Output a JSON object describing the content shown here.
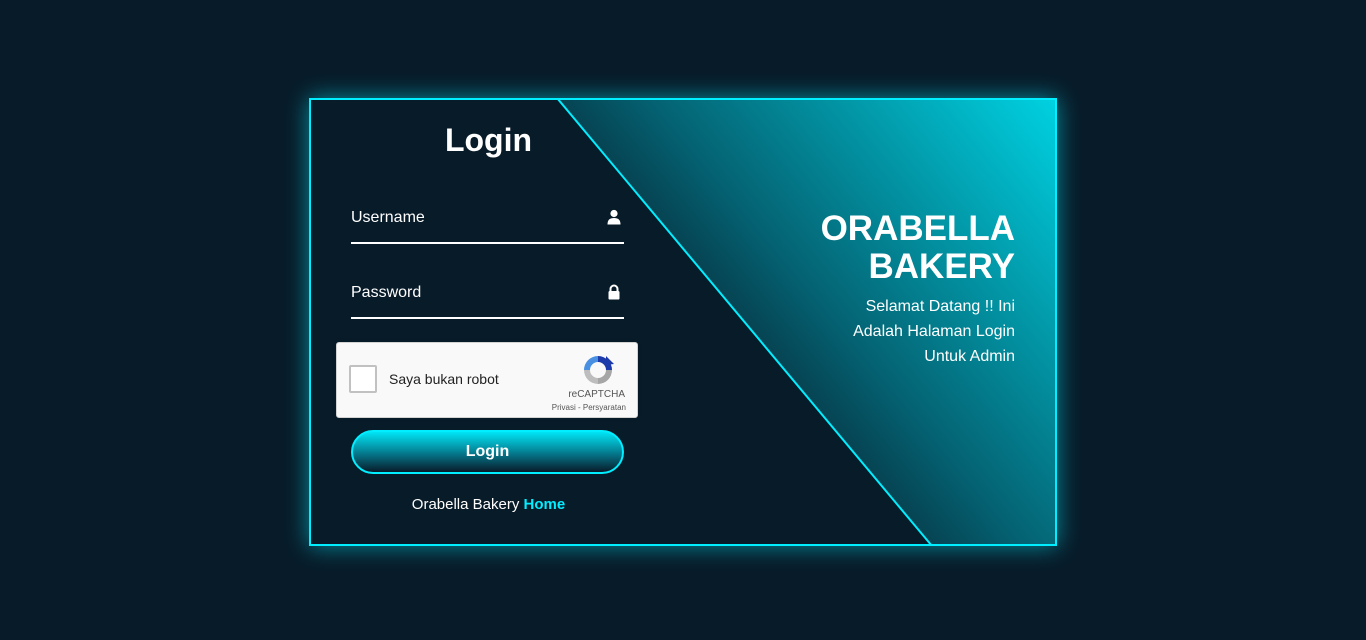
{
  "login": {
    "title": "Login",
    "username_placeholder": "Username",
    "password_placeholder": "Password",
    "button_label": "Login"
  },
  "captcha": {
    "label": "Saya bukan robot",
    "brand": "reCAPTCHA",
    "privacy": "Privasi",
    "separator": " - ",
    "terms": "Persyaratan"
  },
  "footer": {
    "text": "Orabella Bakery",
    "link": "Home"
  },
  "info": {
    "title": "ORABELLA BAKERY",
    "welcome": "Selamat Datang !! Ini Adalah Halaman Login Untuk Admin"
  },
  "colors": {
    "accent": "#00eeff",
    "background": "#081b29"
  },
  "icons": {
    "username": "user-icon",
    "password": "lock-icon",
    "captcha": "recaptcha-logo-icon"
  }
}
